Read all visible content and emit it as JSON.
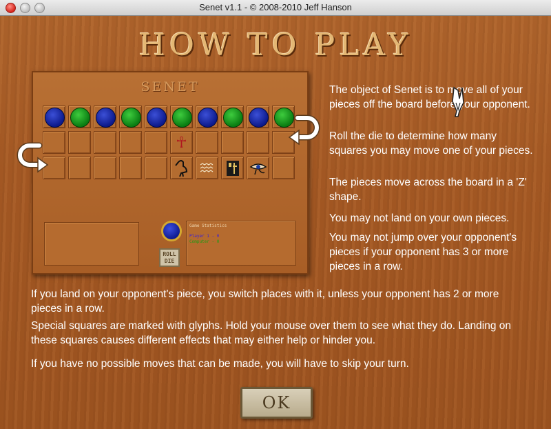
{
  "window": {
    "title": "Senet v1.1 - © 2008-2010 Jeff Hanson",
    "controls": [
      "close",
      "minimize",
      "zoom"
    ]
  },
  "heading": "HOW TO PLAY",
  "board": {
    "title": "SENET",
    "rows": [
      [
        "blue",
        "green",
        "blue",
        "green",
        "blue",
        "green",
        "blue",
        "green",
        "blue",
        "green"
      ],
      [
        "",
        "",
        "",
        "",
        "",
        "ankh",
        "",
        "",
        "",
        ""
      ],
      [
        "",
        "",
        "",
        "",
        "",
        "ibis-glyph",
        "water-glyph",
        "figure-glyph",
        "eye-of-horus-glyph",
        ""
      ]
    ],
    "stats_title": "Game Statistics",
    "player1": "Player 1 - 0",
    "computer": "Computer - 0",
    "roll_label_1": "ROLL",
    "roll_label_2": "DIE"
  },
  "paragraphs": {
    "p1": "The object of Senet is to move all of your pieces off the board before your opponent.",
    "p2": "Roll the die to determine how many squares you may move one of your pieces.",
    "p3": "The pieces move across the board in a 'Z' shape.",
    "p4": "You may not land on your own pieces.",
    "p5": "You may not jump over your opponent's pieces if your opponent has 3 or more pieces in a row.",
    "p6": "If you land on your opponent's piece, you switch places with it, unless your opponent has 2 or more pieces in a row.",
    "p7": "Special squares are marked with glyphs.  Hold your mouse over them to see what they do. Landing on these squares causes different effects that may either help or hinder you.",
    "p8": "If you have no possible moves that can be made, you will have to skip your turn."
  },
  "ok_label": "OK",
  "colors": {
    "wood": "#a75a24",
    "heading": "#e4b774",
    "piece_blue": "#0d1a8c",
    "piece_green": "#0a7d12",
    "text": "#ffffff"
  }
}
